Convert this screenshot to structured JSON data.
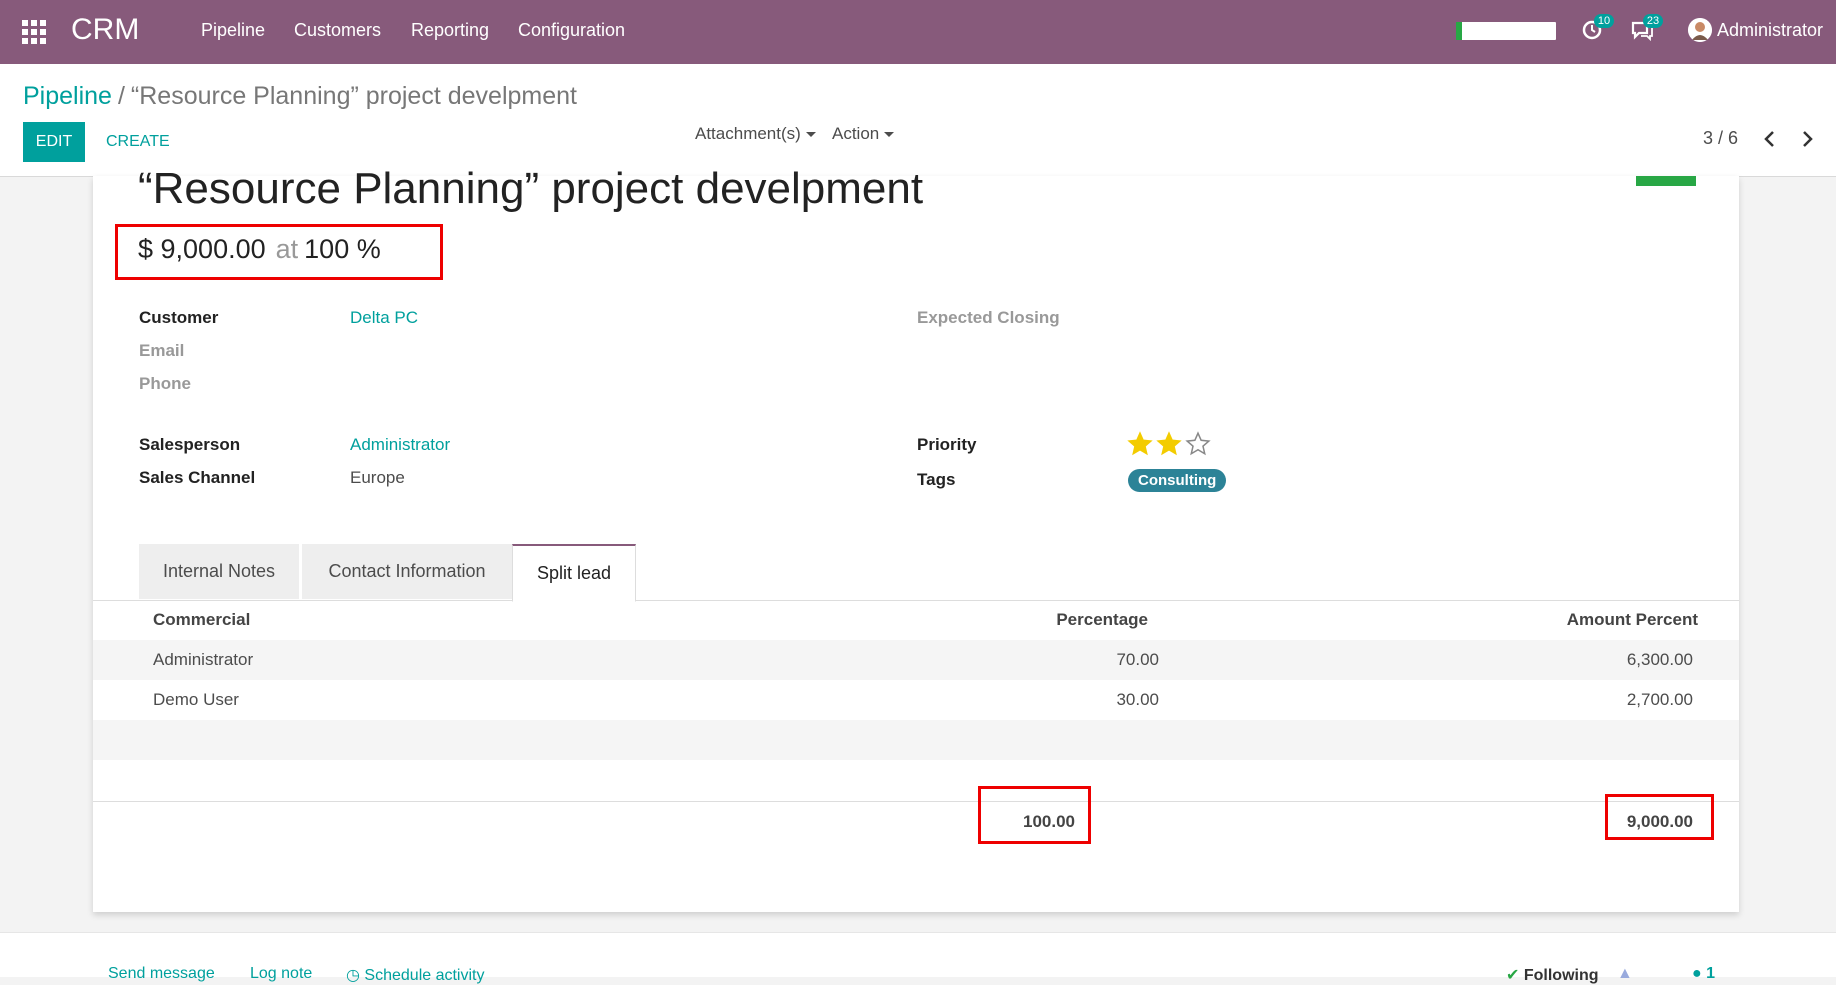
{
  "topnav": {
    "app_name": "CRM",
    "menus": [
      "Pipeline",
      "Customers",
      "Reporting",
      "Configuration"
    ],
    "progress": 0.06,
    "activity_count": "10",
    "message_count": "23",
    "user_name": "Administrator"
  },
  "breadcrumb": {
    "parent": "Pipeline",
    "separator": "/",
    "current": "“Resource Planning” project develpment"
  },
  "buttons": {
    "edit": "EDIT",
    "create": "CREATE"
  },
  "dropdowns": {
    "attachments": "Attachment(s)",
    "action": "Action"
  },
  "pager": "3 / 6",
  "record": {
    "title": "“Resource Planning” project develpment",
    "revenue": "$ 9,000.00",
    "at": "at",
    "probability": "100 %",
    "fields": {
      "customer_label": "Customer",
      "customer_value": "Delta PC",
      "email_label": "Email",
      "phone_label": "Phone",
      "expected_closing_label": "Expected Closing",
      "salesperson_label": "Salesperson",
      "salesperson_value": "Administrator",
      "sales_channel_label": "Sales Channel",
      "sales_channel_value": "Europe",
      "priority_label": "Priority",
      "priority_stars": 2,
      "priority_max": 3,
      "tags_label": "Tags",
      "tag": "Consulting"
    }
  },
  "tabs": [
    "Internal Notes",
    "Contact Information",
    "Split lead"
  ],
  "active_tab": "Split lead",
  "split_table": {
    "headers": [
      "Commercial",
      "Percentage",
      "Amount Percent"
    ],
    "rows": [
      [
        "Administrator",
        "70.00",
        "6,300.00"
      ],
      [
        "Demo User",
        "30.00",
        "2,700.00"
      ]
    ],
    "totals": [
      "100.00",
      "9,000.00"
    ]
  },
  "chatter": {
    "send_message": "Send message",
    "log_note": "Log note",
    "schedule_activity": "Schedule activity",
    "following": "Following",
    "followers": "1"
  },
  "colors": {
    "brand": "#875a7b",
    "accent": "#00a09d",
    "highlight": "#e00000",
    "tag": "#2c8397",
    "won": "#28a745"
  }
}
